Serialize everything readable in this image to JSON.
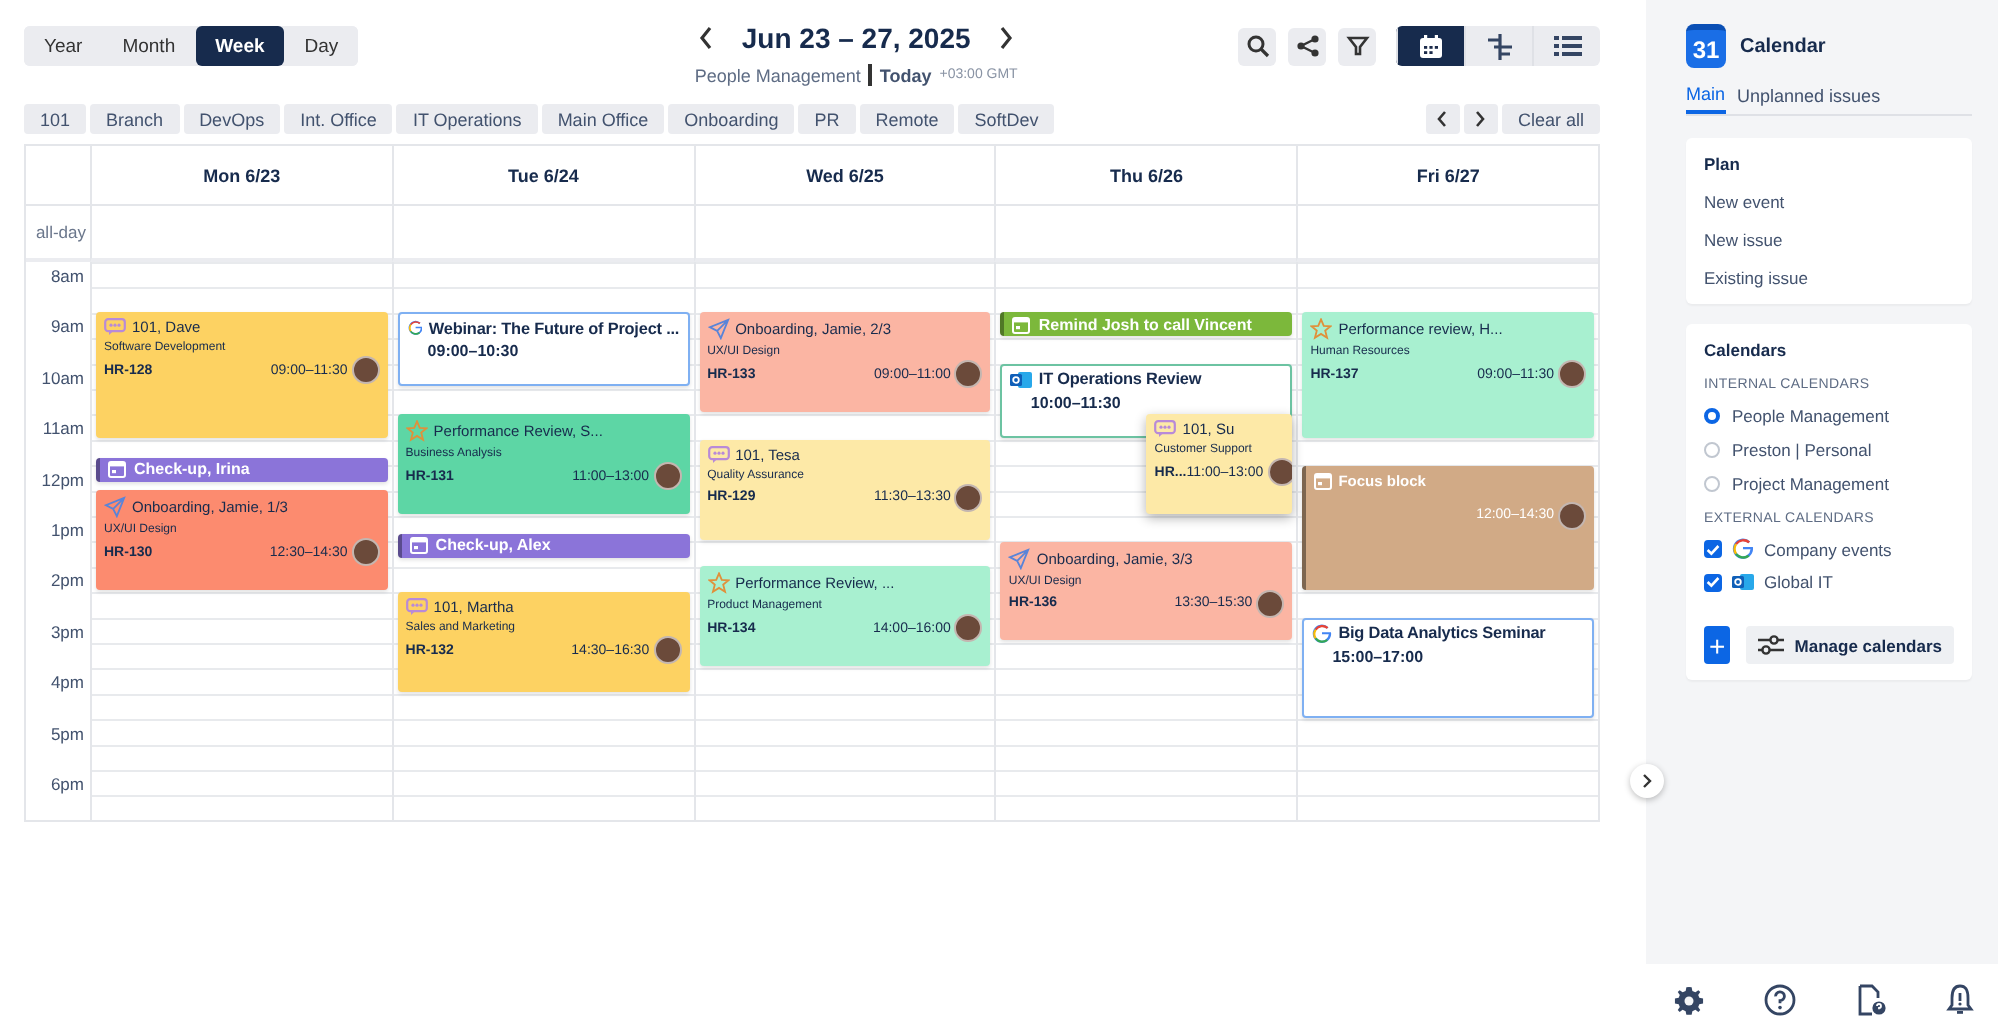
{
  "views": [
    {
      "label": "Year",
      "selected": false
    },
    {
      "label": "Month",
      "selected": false
    },
    {
      "label": "Week",
      "selected": true
    },
    {
      "label": "Day",
      "selected": false
    }
  ],
  "range_title": "Jun 23 – 27, 2025",
  "subtitle": {
    "calendar": "People Management",
    "today": "Today",
    "timezone": "+03:00 GMT"
  },
  "layout_modes": [
    {
      "kind": "calendar",
      "selected": true
    },
    {
      "kind": "timeline",
      "selected": false
    },
    {
      "kind": "list",
      "selected": false
    }
  ],
  "filters": [
    "101",
    "Branch",
    "DevOps",
    "Int. Office",
    "IT Operations",
    "Main Office",
    "Onboarding",
    "PR",
    "Remote",
    "SoftDev"
  ],
  "clear_all": "Clear all",
  "all_day_label": "all-day",
  "hours": [
    "8am",
    "9am",
    "10am",
    "11am",
    "12pm",
    "1pm",
    "2pm",
    "3pm",
    "4pm",
    "5pm",
    "6pm"
  ],
  "days": [
    {
      "label": "Mon 6/23",
      "events": [
        {
          "kind": "meeting",
          "title": "101, Dave",
          "subtitle": "Software Development",
          "key": "HR-128",
          "time": "09:00–11:30",
          "color": "#fdd262"
        },
        {
          "kind": "reminder",
          "title": "Check-up, Irina",
          "color": "#8b74d9"
        },
        {
          "kind": "onboarding",
          "title": "Onboarding, Jamie, 1/3",
          "subtitle": "UX/UI Design",
          "key": "HR-130",
          "time": "12:30–14:30",
          "color": "#fc8b6f"
        }
      ]
    },
    {
      "label": "Tue 6/24",
      "events": [
        {
          "kind": "google",
          "title": "Webinar: The Future of Project ...",
          "time": "09:00–10:30",
          "color": "#7fb0f2"
        },
        {
          "kind": "review",
          "title": "Performance Review, S...",
          "subtitle": "Business Analysis",
          "key": "HR-131",
          "time": "11:00–13:00",
          "color": "#5dd6a5"
        },
        {
          "kind": "reminder",
          "title": "Check-up, Alex",
          "color": "#8b74d9"
        },
        {
          "kind": "meeting",
          "title": "101, Martha",
          "subtitle": "Sales and Marketing",
          "key": "HR-132",
          "time": "14:30–16:30",
          "color": "#fdd262"
        }
      ]
    },
    {
      "label": "Wed 6/25",
      "events": [
        {
          "kind": "onboarding",
          "title": "Onboarding, Jamie, 2/3",
          "subtitle": "UX/UI Design",
          "key": "HR-133",
          "time": "09:00–11:00",
          "color": "#fbb5a3"
        },
        {
          "kind": "meeting",
          "title": "101, Tesa",
          "subtitle": "Quality Assurance",
          "key": "HR-129",
          "time": "11:30–13:30",
          "color": "#fde9a7"
        },
        {
          "kind": "review",
          "title": "Performance Review, ...",
          "subtitle": "Product Management",
          "key": "HR-134",
          "time": "14:00–16:00",
          "color": "#a8f0d0"
        }
      ]
    },
    {
      "label": "Thu 6/26",
      "events": [
        {
          "kind": "reminder",
          "title": "Remind Josh to call Vincent",
          "color": "#7cb83b"
        },
        {
          "kind": "outlook",
          "title": "IT Operations Review",
          "time": "10:00–11:30",
          "color": "#6cc3a2"
        },
        {
          "kind": "meeting",
          "title": "101, Su",
          "subtitle": "Customer Support",
          "key": "HR...",
          "time": "11:00–13:00",
          "color": "#fde9a7"
        },
        {
          "kind": "onboarding",
          "title": "Onboarding, Jamie, 3/3",
          "subtitle": "UX/UI Design",
          "key": "HR-136",
          "time": "13:30–15:30",
          "color": "#fbb5a3"
        }
      ]
    },
    {
      "label": "Fri 6/27",
      "events": [
        {
          "kind": "review",
          "title": "Performance review, H...",
          "subtitle": "Human Resources",
          "key": "HR-137",
          "time": "09:00–11:30",
          "color": "#a8f0d0"
        },
        {
          "kind": "block",
          "title": "Focus block",
          "time": "12:00–14:30",
          "color": "#d1aa86"
        },
        {
          "kind": "google",
          "title": "Big Data Analytics Seminar",
          "time": "15:00–17:00",
          "color": "#7fb0f2"
        }
      ]
    }
  ],
  "sidebar": {
    "logo_text": "31",
    "title": "Calendar",
    "tabs": [
      {
        "label": "Main",
        "selected": true
      },
      {
        "label": "Unplanned issues",
        "selected": false
      }
    ],
    "plan": {
      "title": "Plan",
      "items": [
        "New event",
        "New issue",
        "Existing issue"
      ]
    },
    "calendars": {
      "title": "Calendars",
      "internal_heading": "INTERNAL CALENDARS",
      "internal": [
        {
          "label": "People Management",
          "selected": true
        },
        {
          "label": "Preston | Personal",
          "selected": false
        },
        {
          "label": "Project Management",
          "selected": false
        }
      ],
      "external_heading": "EXTERNAL CALENDARS",
      "external": [
        {
          "label": "Company events",
          "kind": "google",
          "checked": true
        },
        {
          "label": "Global IT",
          "kind": "outlook",
          "checked": true
        }
      ],
      "add_button": "+",
      "manage_button": "Manage calendars"
    }
  }
}
